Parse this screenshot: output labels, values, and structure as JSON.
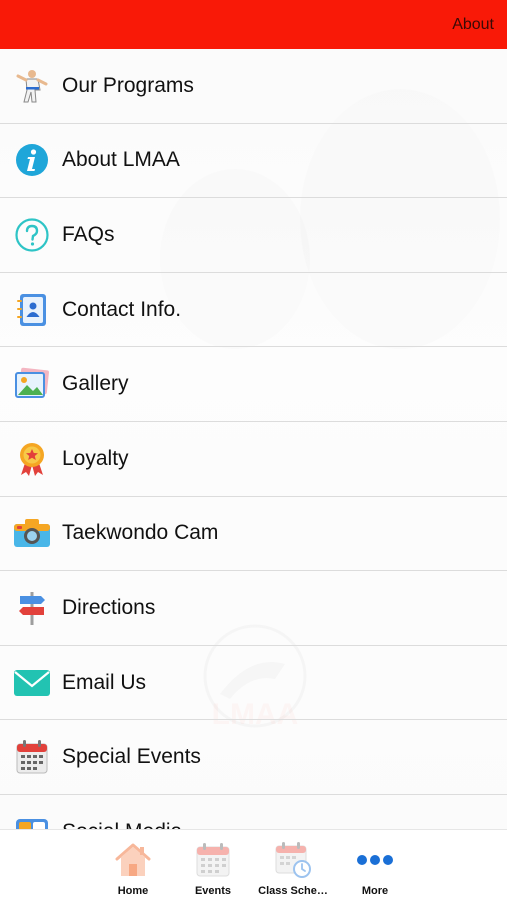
{
  "header": {
    "title": "About"
  },
  "menu": {
    "items": [
      {
        "label": "Our Programs",
        "icon": "karate-figure-icon"
      },
      {
        "label": "About LMAA",
        "icon": "info-icon"
      },
      {
        "label": "FAQs",
        "icon": "question-icon"
      },
      {
        "label": "Contact Info.",
        "icon": "contact-book-icon"
      },
      {
        "label": "Gallery",
        "icon": "gallery-icon"
      },
      {
        "label": "Loyalty",
        "icon": "medal-icon"
      },
      {
        "label": "Taekwondo Cam",
        "icon": "camera-icon"
      },
      {
        "label": "Directions",
        "icon": "signpost-icon"
      },
      {
        "label": "Email Us",
        "icon": "envelope-icon"
      },
      {
        "label": "Special Events",
        "icon": "calendar-icon"
      },
      {
        "label": "Social Media",
        "icon": "social-media-icon"
      }
    ]
  },
  "watermark": {
    "text": "LMAA"
  },
  "tabbar": {
    "items": [
      {
        "label": "Home",
        "icon": "home-icon"
      },
      {
        "label": "Events",
        "icon": "calendar-icon"
      },
      {
        "label": "Class Sche…",
        "icon": "schedule-clock-icon"
      },
      {
        "label": "More",
        "icon": "more-dots-icon"
      }
    ]
  },
  "colors": {
    "header_bg": "#f91907",
    "accent_blue": "#1a6fd6"
  }
}
